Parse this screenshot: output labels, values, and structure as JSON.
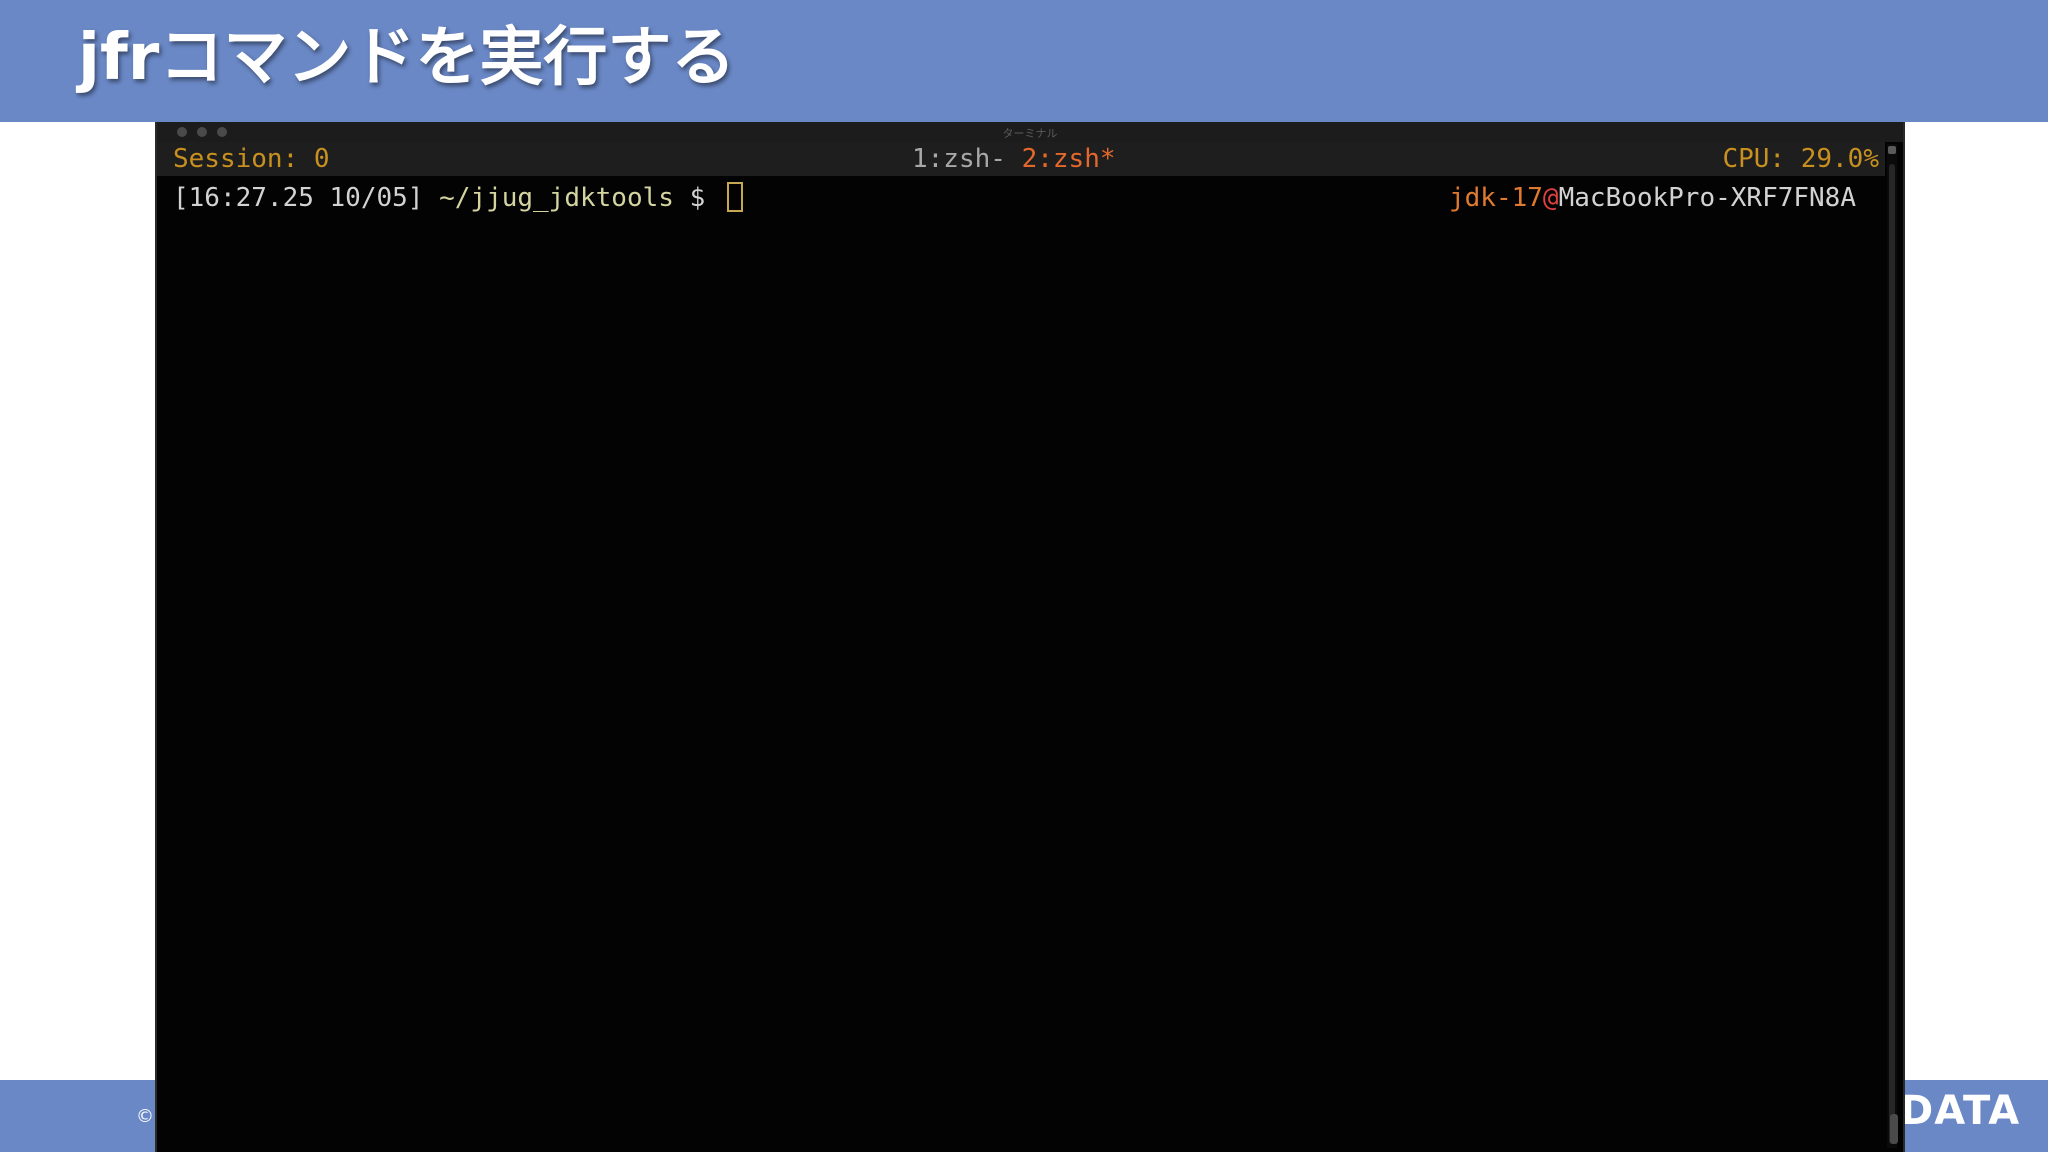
{
  "slide": {
    "title": "jfrコマンドを実行する",
    "copyright_symbol": "©",
    "footer_logo_text": "DATA"
  },
  "terminal": {
    "window_title": "ターミナル",
    "status_bar": {
      "session": "Session: 0",
      "tabs": [
        {
          "label": "1:zsh-",
          "active": false
        },
        {
          "label": "2:zsh*",
          "active": true
        }
      ],
      "cpu": "CPU: 29.0%"
    },
    "prompt": {
      "time": "[16:27.25 10/05]",
      "path": "~/jjug_jdktools",
      "symbol": "$",
      "jdk": "jdk-17",
      "at": "@",
      "host": "MacBookPro-XRF7FN8A"
    }
  },
  "colors": {
    "header_bg": "#6a88c6",
    "terminal_bg": "#030303",
    "status_orange": "#c8901e",
    "active_tab": "#e4682c"
  },
  "icons": [
    "close-icon",
    "minimize-icon",
    "zoom-icon",
    "copyright-icon"
  ]
}
